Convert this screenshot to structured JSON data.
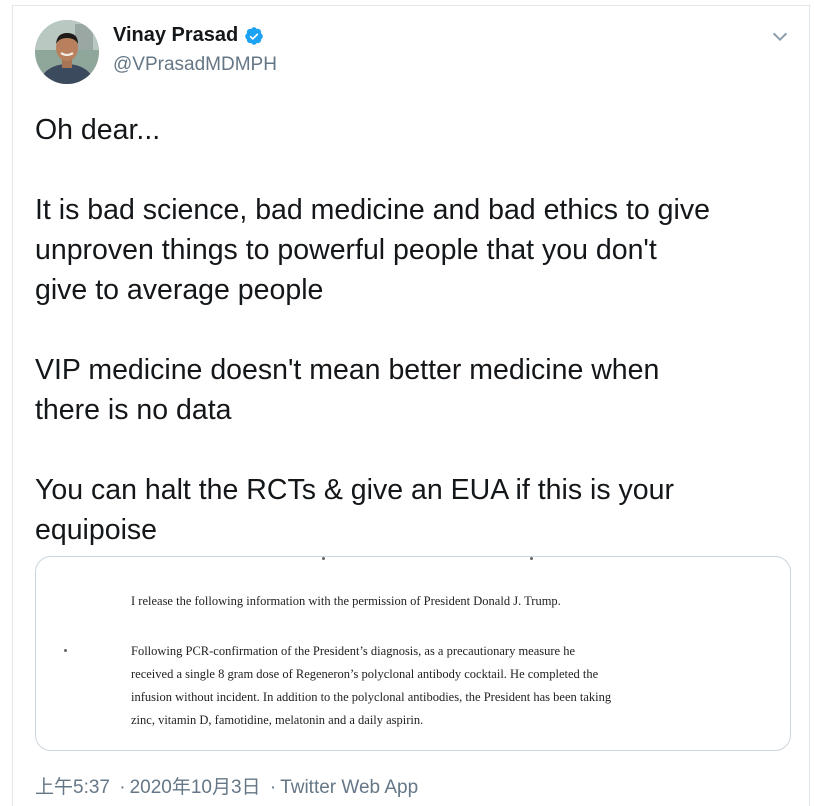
{
  "author": {
    "name": "Vinay Prasad",
    "handle": "@VPrasadMDMPH",
    "verified_icon": "verified-badge-icon",
    "verified_color": "#1da1f2"
  },
  "tweet": {
    "paragraphs": [
      "Oh dear...",
      "It is bad science, bad medicine and bad ethics to give\nunproven things to powerful people that you don't\ngive to average people",
      "VIP medicine doesn't mean better medicine when\nthere is no data",
      "You can halt the RCTs & give an EUA if this is your\nequipoise"
    ]
  },
  "media": {
    "line1": "I release the following information with the permission of President Donald J. Trump.",
    "paragraph_lines": [
      "Following PCR-confirmation of the President’s diagnosis, as a precautionary measure he",
      "received a single 8 gram dose of Regeneron’s polyclonal antibody cocktail.  He completed the",
      "infusion without incident.  In addition to the polyclonal antibodies, the President has been taking",
      "zinc, vitamin D, famotidine, melatonin and a daily aspirin."
    ]
  },
  "meta": {
    "time": "上午5:37",
    "date": "2020年10月3日",
    "separator": "·",
    "source": "Twitter Web App"
  },
  "colors": {
    "text": "#14171a",
    "secondary": "#657786",
    "border": "#e1e8ed"
  }
}
